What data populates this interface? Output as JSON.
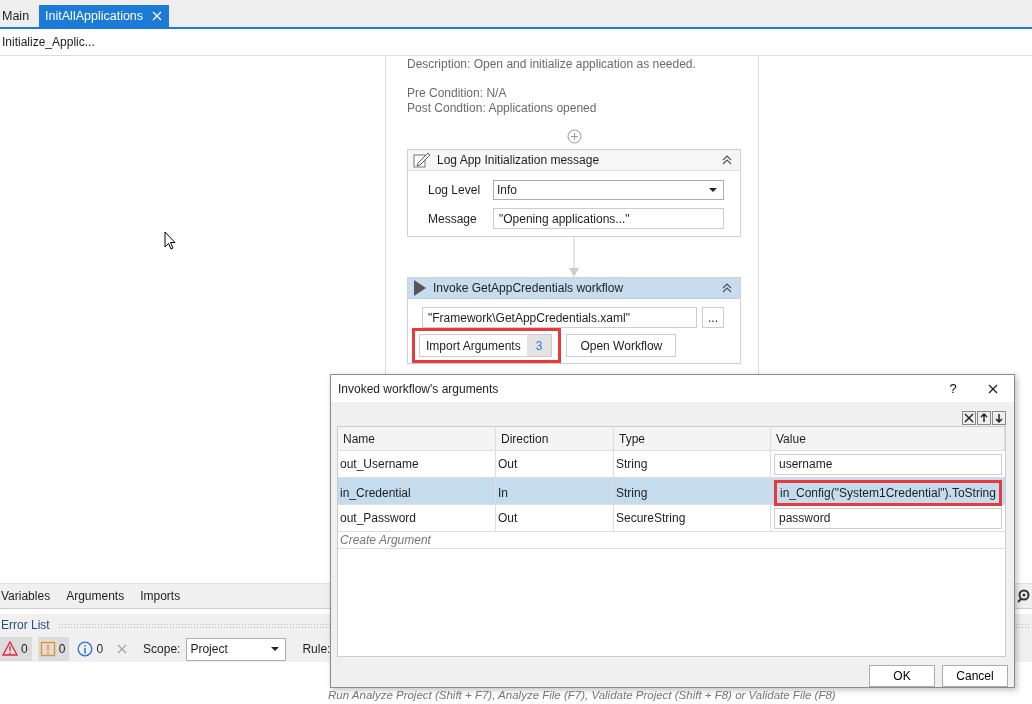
{
  "tabs": [
    {
      "label": "Main",
      "selected": false,
      "closable": false
    },
    {
      "label": "InitAllApplications",
      "selected": true,
      "closable": true
    }
  ],
  "breadcrumb": "Initialize_Applic...",
  "designer": {
    "description": "Description: Open and initialize application as needed.",
    "pre_condition": "Pre Condition: N/A",
    "post_condition": "Post Condtion: Applications opened",
    "activities": [
      {
        "kind": "log",
        "title": "Log App Initialization message",
        "selected": false,
        "fields": [
          {
            "label": "Log Level",
            "value": "Info",
            "kind": "dropdown"
          },
          {
            "label": "Message",
            "value": "\"Opening applications...\"",
            "kind": "text"
          }
        ]
      },
      {
        "kind": "invoke",
        "title": "Invoke GetAppCredentials workflow",
        "selected": true,
        "path": "\"Framework\\GetAppCredentials.xaml\"",
        "browse_button": "...",
        "import_button": "Import Arguments",
        "argument_count": "3",
        "open_button": "Open Workflow",
        "highlighted": true
      }
    ]
  },
  "bottom_tabs": [
    {
      "label": "Variables"
    },
    {
      "label": "Arguments"
    },
    {
      "label": "Imports"
    }
  ],
  "error_list": {
    "title": "Error List",
    "filters": [
      {
        "kind": "error",
        "count": "0",
        "selected": true
      },
      {
        "kind": "warning",
        "count": "0",
        "selected": true
      },
      {
        "kind": "info",
        "count": "0",
        "selected": false
      }
    ],
    "scope_label": "Scope:",
    "scope": "Project",
    "rule_label": "Rule:",
    "hint": "Run Analyze Project (Shift + F7), Analyze File (F7), Validate Project (Shift + F8) or Validate File (F8)"
  },
  "dialog": {
    "title": "Invoked workflow's arguments",
    "help": "?",
    "columns": [
      "Name",
      "Direction",
      "Type",
      "Value"
    ],
    "rows": [
      {
        "name": "out_Username",
        "direction": "Out",
        "type": "String",
        "value": "username",
        "selected": false,
        "highlighted": false
      },
      {
        "name": "in_Credential",
        "direction": "In",
        "type": "String",
        "value": "in_Config(\"System1Credential\").ToString",
        "selected": true,
        "highlighted": true
      },
      {
        "name": "out_Password",
        "direction": "Out",
        "type": "SecureString",
        "value": "password",
        "selected": false,
        "highlighted": false
      }
    ],
    "create_placeholder": "Create Argument",
    "buttons": [
      "OK",
      "Cancel"
    ]
  }
}
